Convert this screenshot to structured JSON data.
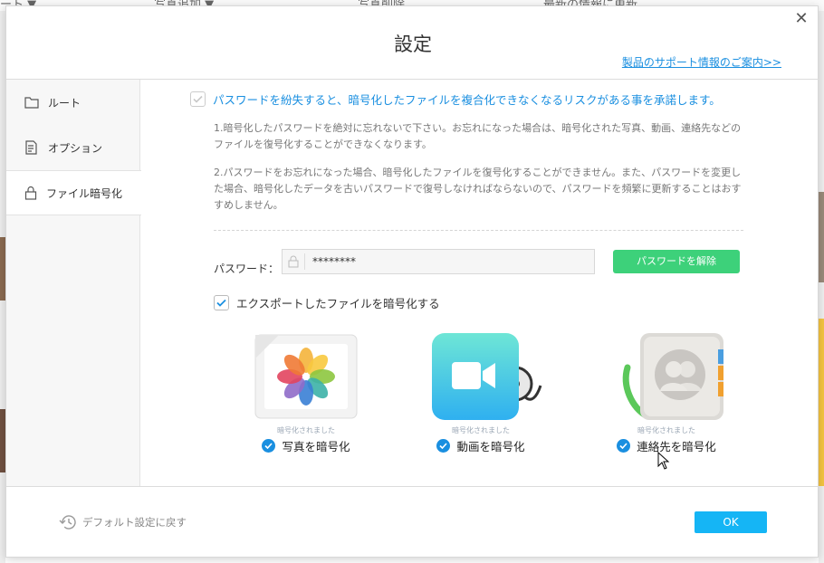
{
  "background": {
    "top_fragments": [
      "ート ▼",
      "写真追加 ▼",
      "写真削除",
      "最新の情報に更新"
    ]
  },
  "dialog": {
    "title": "設定",
    "close_glyph": "✕",
    "support_link": "製品のサポート情報のご案内>>"
  },
  "sidebar": {
    "items": [
      {
        "label": "ルート",
        "icon": "folder-icon"
      },
      {
        "label": "オプション",
        "icon": "options-icon"
      },
      {
        "label": "ファイル暗号化",
        "icon": "lock-icon",
        "active": true
      }
    ]
  },
  "encryption": {
    "acknowledge": "パスワードを紛失すると、暗号化したファイルを複合化できなくなるリスクがある事を承諾します。",
    "note1": "1.暗号化したパスワードを絶対に忘れないで下さい。お忘れになった場合は、暗号化された写真、動画、連絡先などのファイルを復号化することができなくなります。",
    "note2": "2.パスワードをお忘れになった場合、暗号化したファイルを復号化することができません。また、パスワードを変更した場合、暗号化したデータを古いパスワードで復号しなければならないので、パスワードを頻繁に更新することはおすすめしません。",
    "password_label": "パスワード：",
    "password_value": "********",
    "unlock_button": "パスワードを解除",
    "export_label": "エクスポートしたファイルを暗号化する",
    "options": [
      {
        "status": "暗号化されました",
        "label": "写真を暗号化",
        "icon": "photos-icon"
      },
      {
        "status": "暗号化されました",
        "label": "動画を暗号化",
        "icon": "video-icon"
      },
      {
        "status": "暗号化されました",
        "label": "連絡先を暗号化",
        "icon": "contacts-icon"
      }
    ]
  },
  "footer": {
    "reset_label": "デフォルト設定に戻す",
    "ok_label": "OK"
  },
  "colors": {
    "accent_blue": "#1a8fe0",
    "green_button": "#3dd17a",
    "ok_button": "#15b5f5"
  }
}
